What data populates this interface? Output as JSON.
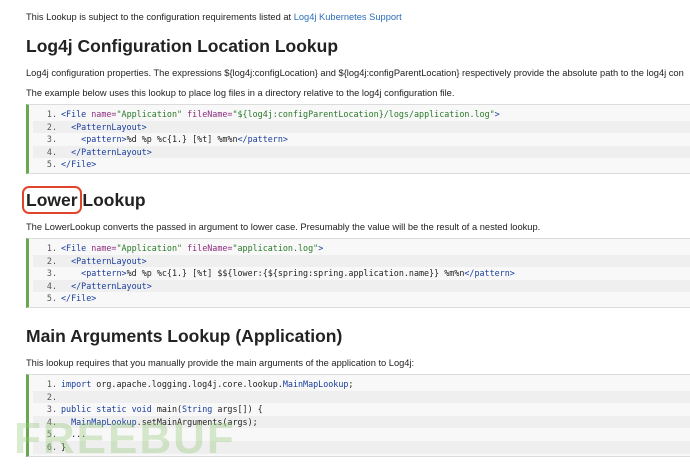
{
  "intro": {
    "text": "This Lookup is subject to the configuration requirements listed at ",
    "link": "Log4j Kubernetes Support"
  },
  "section1": {
    "heading": "Log4j Configuration Location Lookup",
    "para1": "Log4j configuration properties. The expressions ${log4j:configLocation} and ${log4j:configParentLocation} respectively provide the absolute path to the log4j con",
    "para2": "The example below uses this lookup to place log files in a directory relative to the log4j configuration file.",
    "code": [
      {
        "n": "1.",
        "parts": [
          {
            "c": "t",
            "v": "<File "
          },
          {
            "c": "a",
            "v": "name="
          },
          {
            "c": "s",
            "v": "\"Application\""
          },
          {
            "c": "a",
            "v": " fileName="
          },
          {
            "c": "s",
            "v": "\"${log4j:configParentLocation}/logs/application.log\""
          },
          {
            "c": "t",
            "v": ">"
          }
        ]
      },
      {
        "n": "2.",
        "parts": [
          {
            "c": "t",
            "v": "  <PatternLayout>"
          }
        ]
      },
      {
        "n": "3.",
        "parts": [
          {
            "c": "t",
            "v": "    <pattern>"
          },
          {
            "c": "plain",
            "v": "%d %p %c{1.} [%t] %m%n"
          },
          {
            "c": "t",
            "v": "</pattern>"
          }
        ]
      },
      {
        "n": "4.",
        "parts": [
          {
            "c": "t",
            "v": "  </PatternLayout>"
          }
        ]
      },
      {
        "n": "5.",
        "parts": [
          {
            "c": "t",
            "v": "</File>"
          }
        ]
      }
    ]
  },
  "section2": {
    "heading_highlight": "Lower",
    "heading_rest": " Lookup",
    "para1": "The LowerLookup converts the passed in argument to lower case. Presumably the value will be the result of a nested lookup.",
    "code": [
      {
        "n": "1.",
        "parts": [
          {
            "c": "t",
            "v": "<File "
          },
          {
            "c": "a",
            "v": "name="
          },
          {
            "c": "s",
            "v": "\"Application\""
          },
          {
            "c": "a",
            "v": " fileName="
          },
          {
            "c": "s",
            "v": "\"application.log\""
          },
          {
            "c": "t",
            "v": ">"
          }
        ]
      },
      {
        "n": "2.",
        "parts": [
          {
            "c": "t",
            "v": "  <PatternLayout>"
          }
        ]
      },
      {
        "n": "3.",
        "parts": [
          {
            "c": "t",
            "v": "    <pattern>"
          },
          {
            "c": "plain",
            "v": "%d %p %c{1.} [%t] $${lower:{${spring:spring.application.name}} %m%n"
          },
          {
            "c": "t",
            "v": "</pattern>"
          }
        ]
      },
      {
        "n": "4.",
        "parts": [
          {
            "c": "t",
            "v": "  </PatternLayout>"
          }
        ]
      },
      {
        "n": "5.",
        "parts": [
          {
            "c": "t",
            "v": "</File>"
          }
        ]
      }
    ]
  },
  "section3": {
    "heading": "Main Arguments Lookup (Application)",
    "para1": "This lookup requires that you manually provide the main arguments of the application to Log4j:",
    "code": [
      {
        "n": "1.",
        "parts": [
          {
            "c": "k",
            "v": "import "
          },
          {
            "c": "plain",
            "v": "org.apache.logging.log4j.core.lookup."
          },
          {
            "c": "t",
            "v": "MainMapLookup"
          },
          {
            "c": "plain",
            "v": ";"
          }
        ]
      },
      {
        "n": "2.",
        "parts": [
          {
            "c": "plain",
            "v": ""
          }
        ]
      },
      {
        "n": "3.",
        "parts": [
          {
            "c": "k",
            "v": "public static void "
          },
          {
            "c": "plain",
            "v": "main("
          },
          {
            "c": "t",
            "v": "String"
          },
          {
            "c": "plain",
            "v": " args[]) {"
          }
        ]
      },
      {
        "n": "4.",
        "parts": [
          {
            "c": "plain",
            "v": "  "
          },
          {
            "c": "t",
            "v": "MainMapLookup"
          },
          {
            "c": "plain",
            "v": ".setMainArguments(args);"
          }
        ]
      },
      {
        "n": "5.",
        "parts": [
          {
            "c": "plain",
            "v": "  ..."
          }
        ]
      },
      {
        "n": "6.",
        "parts": [
          {
            "c": "plain",
            "v": "}"
          }
        ]
      }
    ]
  },
  "watermark": "FREEBUF"
}
